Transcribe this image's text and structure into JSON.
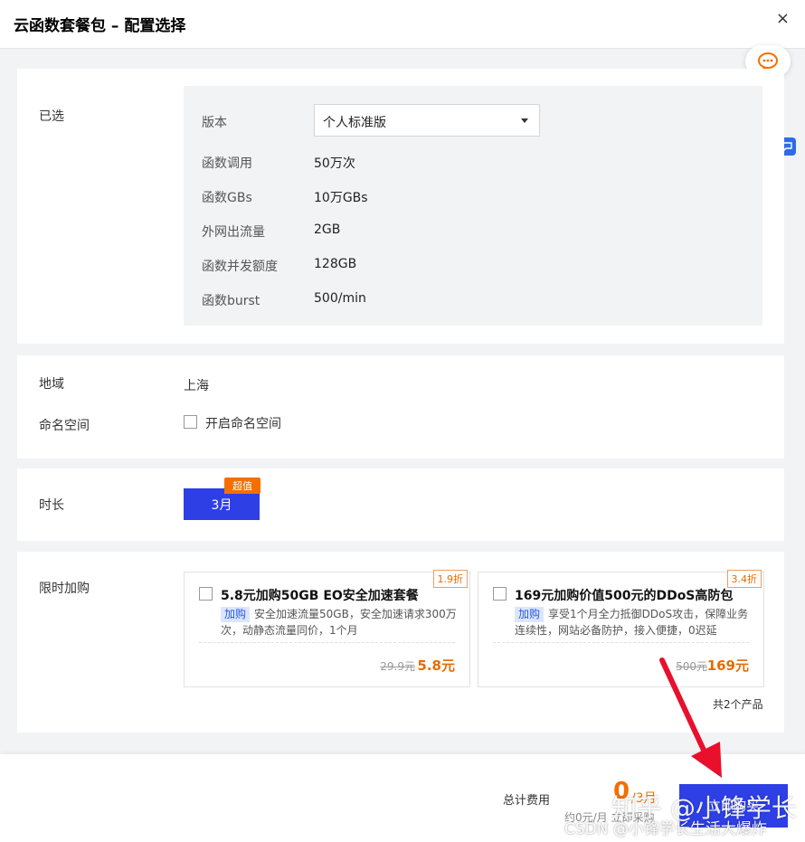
{
  "dialog": {
    "title": "云函数套餐包 – 配置选择",
    "close_label": "×"
  },
  "selected": {
    "section_label": "已选",
    "version_label": "版本",
    "version_value": "个人标准版",
    "rows": [
      {
        "label": "函数调用",
        "value": "50万次"
      },
      {
        "label": "函数GBs",
        "value": "10万GBs"
      },
      {
        "label": "外网出流量",
        "value": "2GB"
      },
      {
        "label": "函数并发额度",
        "value": "128GB"
      },
      {
        "label": "函数burst",
        "value": "500/min"
      }
    ]
  },
  "region": {
    "label": "地域",
    "value": "上海",
    "namespace_label": "命名空间",
    "namespace_checkbox": "开启命名空间"
  },
  "duration": {
    "label": "时长",
    "option": "3月",
    "badge": "超值"
  },
  "addon": {
    "label": "限时加购",
    "count": "共2个产品",
    "cards": [
      {
        "discount": "1.9折",
        "name": "5.8元加购50GB EO安全加速套餐",
        "tag": "加购",
        "desc": "安全加速流量50GB，安全加速请求300万次，动静态流量同价，1个月",
        "orig": "29.9元",
        "price": "5.8元"
      },
      {
        "discount": "3.4折",
        "name": "169元加购价值500元的DDoS高防包",
        "tag": "加购",
        "desc": "享受1个月全力抵御DDoS攻击，保障业务连续性，网站必备防护，接入便捷，0迟延",
        "orig": "500元",
        "price": "169元"
      }
    ]
  },
  "footer": {
    "total_label": "总计费用",
    "total_value": "0",
    "total_unit": "/3月",
    "total_sub": "约0元/月 立即采购",
    "buy_label": "立即购买"
  },
  "watermarks": {
    "line1": "知乎 @小锋学长",
    "line2": "CSDN @小锋学长生活大爆炸"
  },
  "colors": {
    "primary": "#2e3fe6",
    "accent": "#f46f00",
    "arrow": "#e8102d"
  }
}
